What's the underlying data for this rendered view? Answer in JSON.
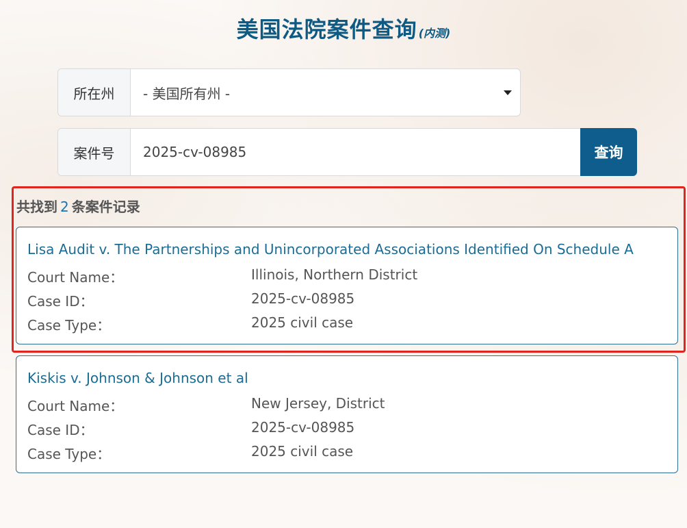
{
  "title": {
    "main": "美国法院案件查询",
    "sub": "(内测)"
  },
  "form": {
    "state_label": "所在州",
    "state_value": "- 美国所有州 -",
    "case_label": "案件号",
    "case_value": "2025-cv-08985",
    "search_label": "查询"
  },
  "results": {
    "prefix": "共找到",
    "count": "2",
    "suffix": "条案件记录",
    "labels": {
      "court": "Court Name：",
      "case_id": "Case ID：",
      "case_type": "Case Type："
    },
    "items": [
      {
        "title": "Lisa Audit v. The Partnerships and Unincorporated Associations Identified On Schedule A",
        "court": "Illinois, Northern District",
        "case_id": "2025-cv-08985",
        "case_type": "2025 civil case"
      },
      {
        "title": "Kiskis v. Johnson & Johnson et al",
        "court": "New Jersey, District",
        "case_id": "2025-cv-08985",
        "case_type": "2025 civil case"
      }
    ]
  },
  "colors": {
    "accent": "#0f5d8c",
    "highlight": "#e0251f",
    "link": "#1b6c95"
  }
}
